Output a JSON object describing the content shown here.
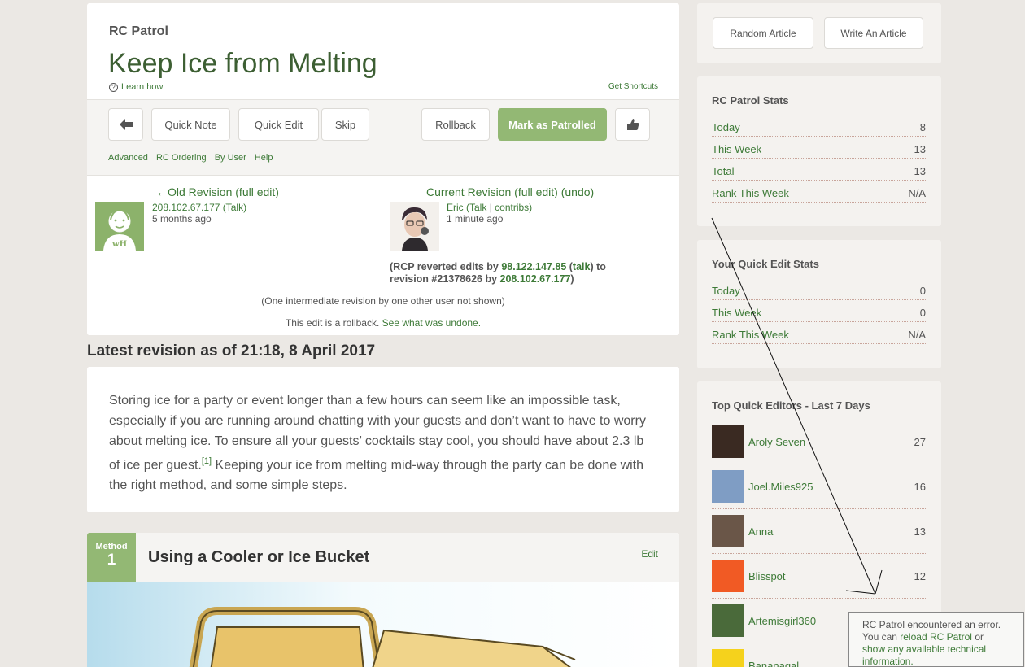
{
  "header": {
    "section_label": "RC Patrol",
    "title": "Keep Ice from Melting",
    "learn_how": "Learn how",
    "get_shortcuts": "Get Shortcuts"
  },
  "toolbar": {
    "quick_note": "Quick Note",
    "quick_edit": "Quick Edit",
    "skip": "Skip",
    "rollback": "Rollback",
    "mark_patrolled": "Mark as Patrolled",
    "links": [
      "Advanced",
      "RC Ordering",
      "By User",
      "Help"
    ]
  },
  "diff": {
    "old": {
      "title_prefix": "←Old Revision",
      "full_edit": "(full edit)",
      "user_ip": "208.102.67.177",
      "talk": "(Talk)",
      "time": "5 months ago",
      "avatar_text": "wH"
    },
    "current": {
      "title_prefix": "Current Revision",
      "full_edit": "(full edit)",
      "undo": "(undo)",
      "user": "Eric",
      "talk_contribs_a": "(Talk",
      "talk_contribs_sep": " | ",
      "talk_contribs_b": "contribs)",
      "time": "1 minute ago"
    },
    "rcp_note": {
      "part1": "(RCP reverted edits by ",
      "ip1": "98.122.147.85",
      "part2": " (",
      "talk": "talk",
      "part3": ") to revision #21378626 by ",
      "ip2": "208.102.67.177",
      "part4": ")"
    },
    "intermediate": "(One intermediate revision by one other user not shown)",
    "rollback_text": "This edit is a rollback. ",
    "rollback_link": "See what was undone."
  },
  "latest_revision": "Latest revision as of 21:18, 8 April 2017",
  "intro": {
    "text_before": "Storing ice for a party or event longer than a few hours can seem like an impossible task, especially if you are running around chatting with your guests and don’t want to have to worry about melting ice. To ensure all your guests’ cocktails stay cool, you should have about 2.3 lb of ice per guest.",
    "ref": "[1]",
    "text_after": " Keeping your ice from melting mid-way through the party can be done with the right method, and some simple steps."
  },
  "method": {
    "word": "Method",
    "number": "1",
    "title": "Using a Cooler or Ice Bucket",
    "edit": "Edit"
  },
  "sidebar": {
    "random_article": "Random Article",
    "write_article": "Write An Article",
    "rc_stats": {
      "title": "RC Patrol Stats",
      "rows": [
        {
          "label": "Today",
          "value": "8"
        },
        {
          "label": "This Week",
          "value": "13"
        },
        {
          "label": "Total",
          "value": "13"
        },
        {
          "label": "Rank This Week",
          "value": "N/A"
        }
      ]
    },
    "qe_stats": {
      "title": "Your Quick Edit Stats",
      "rows": [
        {
          "label": "Today",
          "value": "0"
        },
        {
          "label": "This Week",
          "value": "0"
        },
        {
          "label": "Rank This Week",
          "value": "N/A"
        }
      ]
    },
    "top_editors": {
      "title": "Top Quick Editors - Last 7 Days",
      "rows": [
        {
          "name": "Aroly Seven",
          "count": "27",
          "color": "#3a2a22"
        },
        {
          "name": "Joel.Miles925",
          "count": "16",
          "color": "#7f9dc4"
        },
        {
          "name": "Anna",
          "count": "13",
          "color": "#6a5648"
        },
        {
          "name": "Blisspot",
          "count": "12",
          "color": "#f15a24"
        },
        {
          "name": "Artemisgirl360",
          "count": "",
          "color": "#4a6a3a"
        },
        {
          "name": "Bananagal",
          "count": "",
          "color": "#f5d21c"
        }
      ]
    }
  },
  "error": {
    "line1": "RC Patrol encountered an error.",
    "line2a": "You can ",
    "reload": "reload RC Patrol",
    "line2b": " or",
    "show_info": "show any available technical information."
  },
  "colors": {
    "accent_green": "#93b874",
    "link_green": "#3d7a37",
    "title_green": "#3d5f33",
    "background": "#ebe8e4"
  }
}
